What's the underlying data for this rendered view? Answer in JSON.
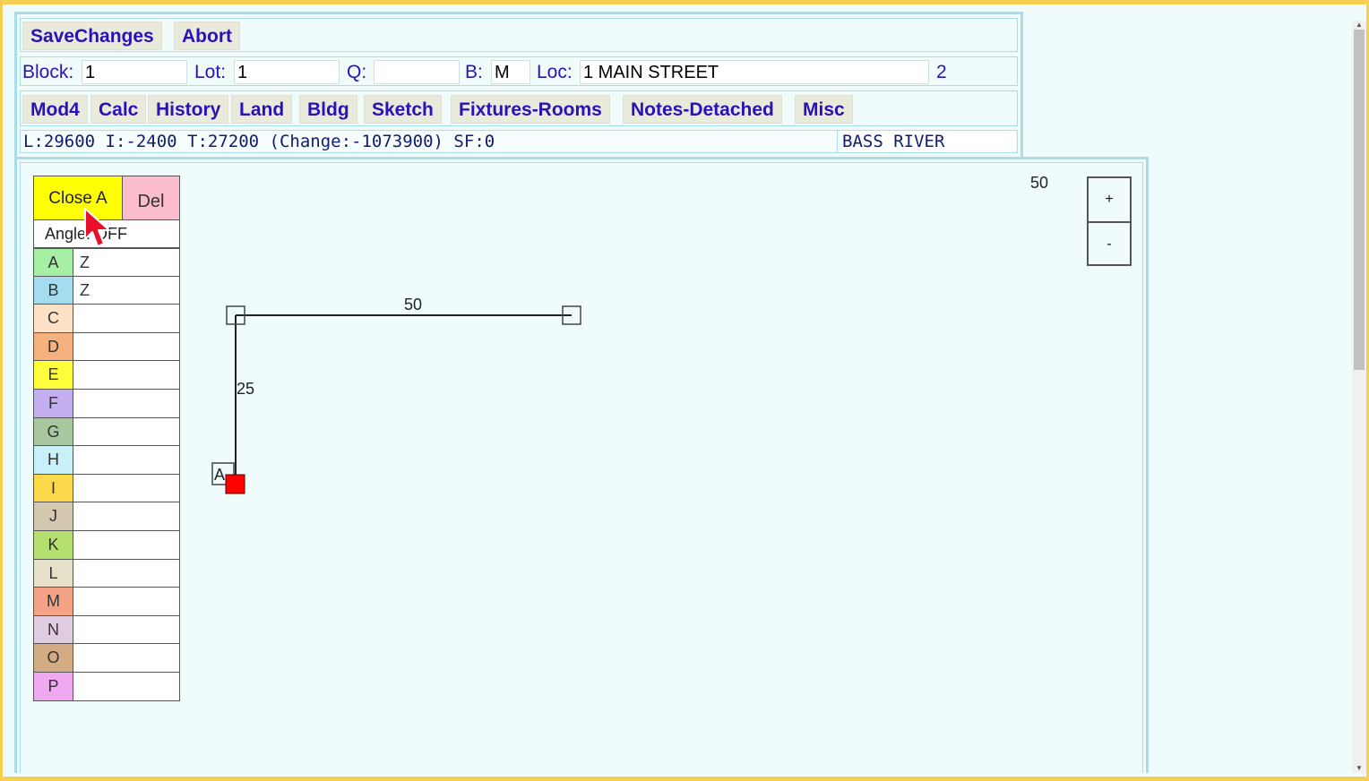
{
  "toolbar": {
    "save_label": "SaveChanges",
    "abort_label": "Abort"
  },
  "parcel": {
    "block_label": "Block:",
    "block_value": "1",
    "lot_label": "Lot:",
    "lot_value": "1",
    "q_label": "Q:",
    "q_value": "",
    "b_label": "B:",
    "b_value": "M",
    "loc_label": "Loc:",
    "loc_value": "1 MAIN STREET",
    "card_number": "2"
  },
  "tabs": [
    "Mod4",
    "Calc",
    "History",
    "Land",
    "Bldg",
    "Sketch",
    "Fixtures-Rooms",
    "Notes-Detached",
    "Misc"
  ],
  "status": {
    "values_text": "L:29600 I:-2400 T:27200 (Change:-1073900) SF:0",
    "town": "BASS RIVER"
  },
  "sketch": {
    "close_label": "Close A",
    "del_label": "Del",
    "angle_label": "Angle: OFF",
    "layers": [
      {
        "key": "A",
        "value": "Z",
        "color": "#a6f0a6"
      },
      {
        "key": "B",
        "value": "Z",
        "color": "#a6dcf0"
      },
      {
        "key": "C",
        "value": "",
        "color": "#fde2c8"
      },
      {
        "key": "D",
        "value": "",
        "color": "#f5b27e"
      },
      {
        "key": "E",
        "value": "",
        "color": "#ffff3c"
      },
      {
        "key": "F",
        "value": "",
        "color": "#c3aef0"
      },
      {
        "key": "G",
        "value": "",
        "color": "#a8c8a0"
      },
      {
        "key": "H",
        "value": "",
        "color": "#c8f0f8"
      },
      {
        "key": "I",
        "value": "",
        "color": "#fcd94a"
      },
      {
        "key": "J",
        "value": "",
        "color": "#d4c8b0"
      },
      {
        "key": "K",
        "value": "",
        "color": "#b4e070"
      },
      {
        "key": "L",
        "value": "",
        "color": "#e6e0c8"
      },
      {
        "key": "M",
        "value": "",
        "color": "#f4a484"
      },
      {
        "key": "N",
        "value": "",
        "color": "#e0cce0"
      },
      {
        "key": "O",
        "value": "",
        "color": "#d4ac84"
      },
      {
        "key": "P",
        "value": "",
        "color": "#f0a8f0"
      }
    ],
    "scale_label": "50",
    "zoom_in_label": "+",
    "zoom_out_label": "-",
    "segment_top_label": "50",
    "segment_left_label": "25",
    "start_point_label": "A"
  }
}
